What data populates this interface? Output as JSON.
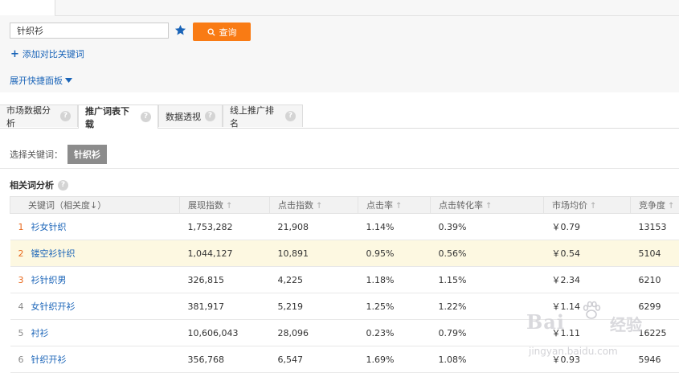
{
  "search": {
    "value": "针织衫",
    "button_label": "查询"
  },
  "links": {
    "add_compare": "添加对比关键词",
    "quick_panel": "展开快捷面板"
  },
  "tabs": [
    {
      "label": "市场数据分析",
      "active": false
    },
    {
      "label": "推广词表下载",
      "active": true
    },
    {
      "label": "数据透视",
      "active": false
    },
    {
      "label": "线上推广排名",
      "active": false
    }
  ],
  "select": {
    "label": "选择关键词：",
    "chip": "针织衫"
  },
  "section": {
    "title": "相关词分析"
  },
  "table": {
    "headers": [
      "关键词（相关度↓）",
      "展现指数",
      "点击指数",
      "点击率",
      "点击转化率",
      "市场均价",
      "竞争度"
    ],
    "rows": [
      {
        "rank": "1",
        "keyword": "衫女针织",
        "impression": "1,753,282",
        "clicks": "21,908",
        "ctr": "1.14%",
        "cvr": "0.39%",
        "price": "￥0.79",
        "competition": "13153"
      },
      {
        "rank": "2",
        "keyword": "镂空衫针织",
        "impression": "1,044,127",
        "clicks": "10,891",
        "ctr": "0.95%",
        "cvr": "0.56%",
        "price": "￥0.54",
        "competition": "5104"
      },
      {
        "rank": "3",
        "keyword": "衫针织男",
        "impression": "326,815",
        "clicks": "4,225",
        "ctr": "1.18%",
        "cvr": "1.15%",
        "price": "￥2.34",
        "competition": "6210"
      },
      {
        "rank": "4",
        "keyword": "女针织开衫",
        "impression": "381,917",
        "clicks": "5,219",
        "ctr": "1.25%",
        "cvr": "1.22%",
        "price": "￥1.14",
        "competition": "6299"
      },
      {
        "rank": "5",
        "keyword": "衬衫",
        "impression": "10,606,043",
        "clicks": "28,096",
        "ctr": "0.23%",
        "cvr": "0.79%",
        "price": "￥1.11",
        "competition": "16225"
      },
      {
        "rank": "6",
        "keyword": "针织开衫",
        "impression": "356,768",
        "clicks": "6,547",
        "ctr": "1.69%",
        "cvr": "1.08%",
        "price": "￥0.93",
        "competition": "5946"
      }
    ]
  },
  "watermark": {
    "word1": "Bai",
    "word2": "经验",
    "url": "jingyan.baidu.com"
  },
  "colors": {
    "accent_orange": "#f97b14",
    "link_blue": "#1a64b8",
    "rank_orange": "#e8691d",
    "highlight_row": "#fdf8e1"
  },
  "icons": {
    "favorite": "star-icon",
    "search": "search-icon",
    "add": "plus-icon",
    "expand": "triangle-down-icon",
    "help": "help-icon",
    "sort": "sort-up-icon"
  }
}
